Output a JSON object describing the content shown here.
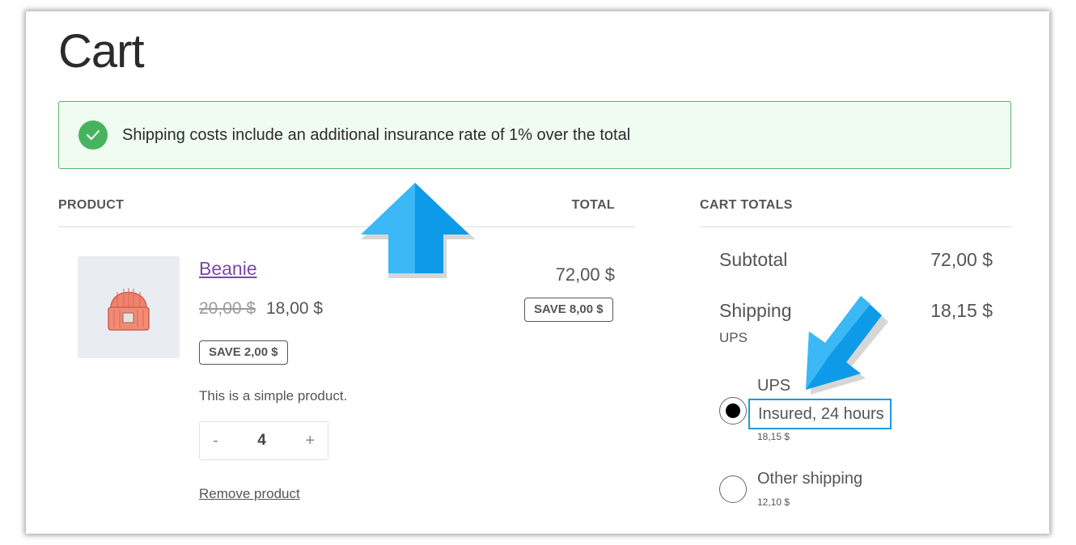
{
  "page": {
    "title": "Cart"
  },
  "notice": {
    "icon": "check-circle-icon",
    "text": "Shipping costs include an additional insurance rate of 1% over the total",
    "color_border": "#59b36b",
    "color_bg": "#f0fbf2"
  },
  "cart_table": {
    "headers": {
      "product": "PRODUCT",
      "total": "TOTAL"
    },
    "item": {
      "name": "Beanie",
      "old_price": "20,00 $",
      "new_price": "18,00 $",
      "unit_saving": "SAVE 2,00 $",
      "description": "This is a simple product.",
      "quantity": {
        "decrement_label": "-",
        "value": "4",
        "increment_label": "+"
      },
      "remove_label": "Remove product",
      "line_total": "72,00 $",
      "line_saving": "SAVE 8,00 $"
    }
  },
  "cart_totals": {
    "heading": "CART TOTALS",
    "subtotal_label": "Subtotal",
    "subtotal_value": "72,00 $",
    "shipping_label": "Shipping",
    "shipping_value": "18,15 $",
    "shipping_carrier": "UPS",
    "options": [
      {
        "title": "UPS",
        "detail": "Insured, 24 hours",
        "price": "18,15 $",
        "selected": true
      },
      {
        "title": "Other shipping",
        "price": "12,10 $",
        "selected": false
      }
    ]
  },
  "colors": {
    "link": "#7a4aa8",
    "arrow": "#12a4ec",
    "highlight": "#1a9be0"
  }
}
